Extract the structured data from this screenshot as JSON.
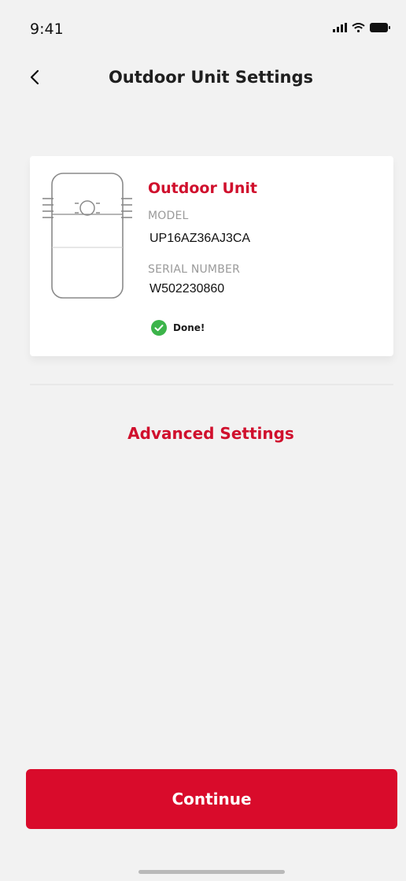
{
  "status_bar": {
    "time": "9:41",
    "icons": [
      "cellular-signal-icon",
      "wifi-icon",
      "battery-icon"
    ]
  },
  "header": {
    "title": "Outdoor Unit Settings",
    "back_icon": "chevron-left-icon"
  },
  "device_card": {
    "name": "Outdoor Unit",
    "model_label": "MODEL",
    "model_value": "UP16AZ36AJ3CA",
    "serial_label": "SERIAL NUMBER",
    "serial_value": "W502230860",
    "status_text": "Done!",
    "status_icon": "check-circle-icon",
    "illustration": "outdoor-unit-icon"
  },
  "advanced_settings_label": "Advanced Settings",
  "continue_label": "Continue",
  "colors": {
    "accent": "#d0102d",
    "button": "#d90b2b",
    "success": "#3cb44a",
    "background": "#f2f2f2"
  }
}
